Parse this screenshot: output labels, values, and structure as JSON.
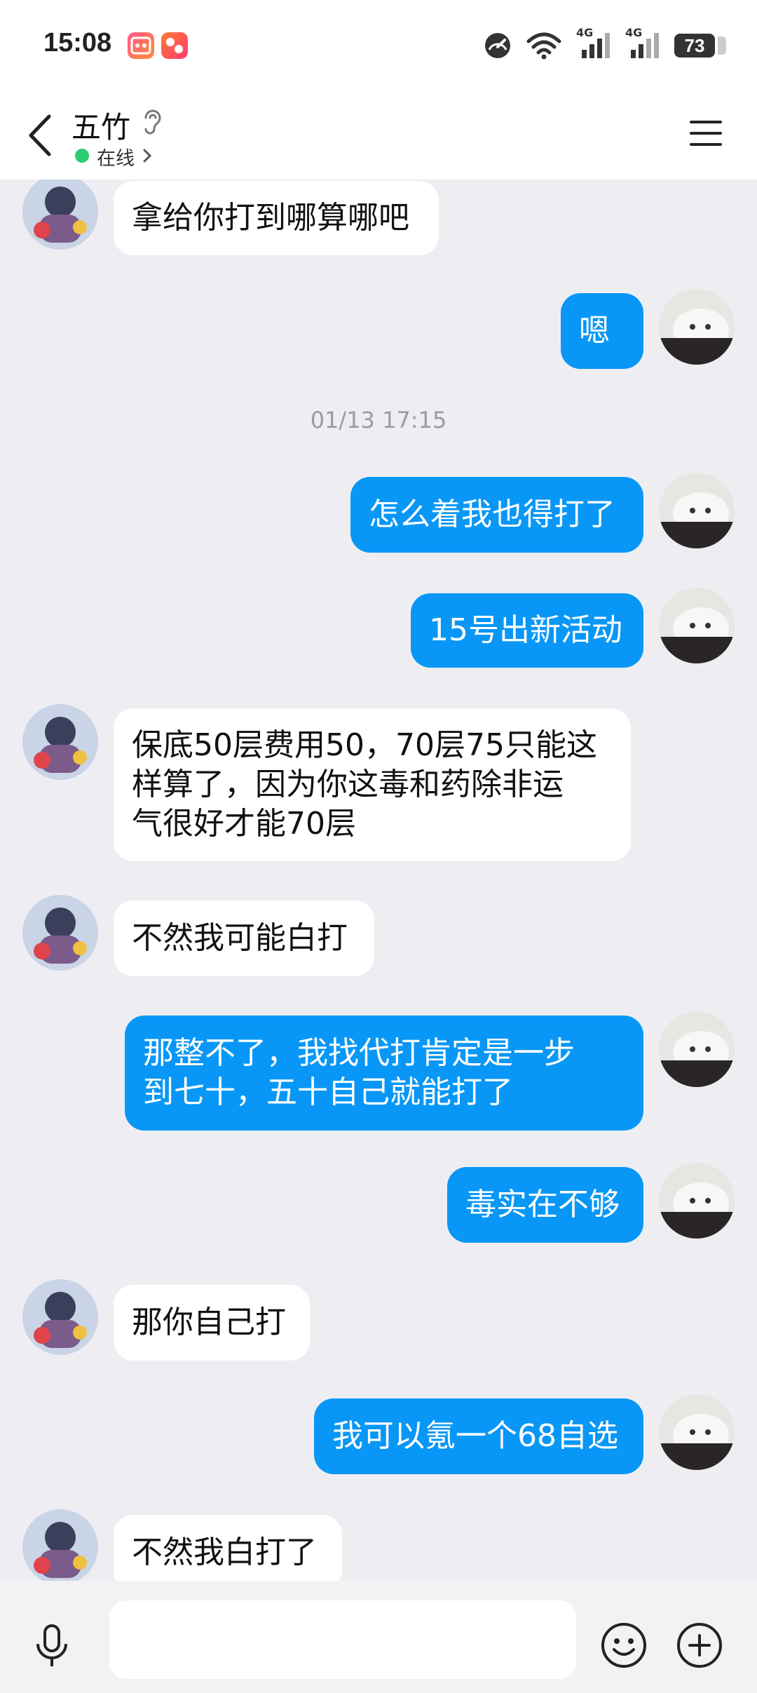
{
  "status_bar": {
    "time": "15:08",
    "battery": "73",
    "network_1": "4G",
    "network_2": "4G",
    "icons": [
      "app-icon-1",
      "app-icon-2",
      "speed-gauge-icon",
      "wifi-icon",
      "signal-icon",
      "signal-icon",
      "battery-icon"
    ]
  },
  "header": {
    "contact_name": "五竹",
    "online_status": "在线",
    "icons": [
      "back-arrow-icon",
      "ear-icon",
      "chevron-right-icon",
      "menu-icon"
    ]
  },
  "chat": {
    "timestamp": "01/13 17:15",
    "messages": [
      {
        "side": "in",
        "text": "拿给你打到哪算哪吧"
      },
      {
        "side": "out",
        "text": "嗯"
      },
      {
        "side": "out",
        "text": "怎么着我也得打了"
      },
      {
        "side": "out",
        "text": "15号出新活动"
      },
      {
        "side": "in",
        "text": "保底50层费用50，70层75只能这\n样算了，因为你这毒和药除非运\n气很好才能70层"
      },
      {
        "side": "in",
        "text": "不然我可能白打"
      },
      {
        "side": "out",
        "text": "那整不了，我找代打肯定是一步\n到七十，五十自己就能打了"
      },
      {
        "side": "out",
        "text": "毒实在不够"
      },
      {
        "side": "in",
        "text": "那你自己打"
      },
      {
        "side": "out",
        "text": "我可以氪一个68自选"
      },
      {
        "side": "in",
        "text": "不然我白打了"
      }
    ]
  },
  "input_bar": {
    "placeholder": "",
    "icons": [
      "microphone-icon",
      "emoji-icon",
      "plus-icon"
    ]
  },
  "colors": {
    "outgoing_bubble": "#0897f6",
    "incoming_bubble": "#ffffff",
    "background": "#eeeef2",
    "online_dot": "#2ecc71"
  }
}
